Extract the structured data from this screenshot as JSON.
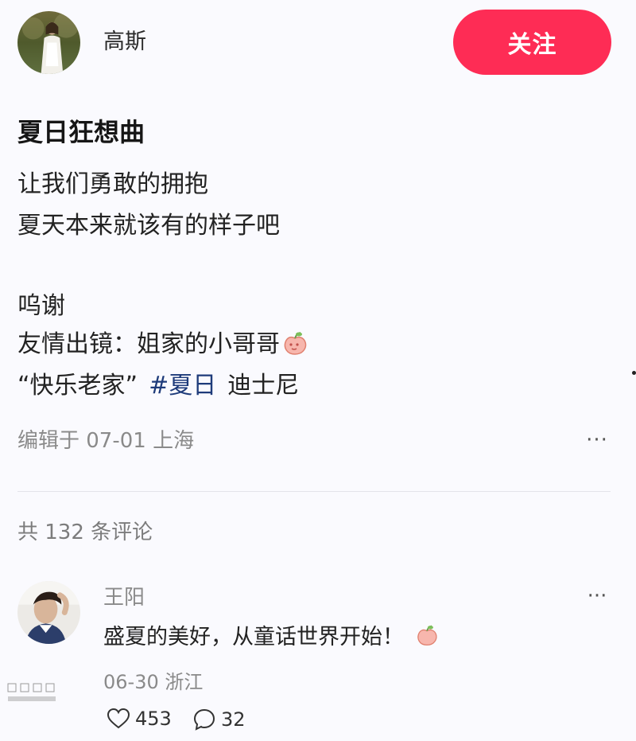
{
  "author": {
    "name": "高斯",
    "avatar_icon": "author-avatar-photo"
  },
  "follow_button": {
    "label": "关注",
    "color": "#fe2c55"
  },
  "post": {
    "title": "夏日狂想曲",
    "lines": [
      "让我们勇敢的拥抱",
      "夏天本来就该有的样子吧",
      "呜谢",
      "友情出镜：姐家的小哥哥"
    ],
    "tag_line": {
      "quote": "“快乐老家”",
      "hashtag": "#夏日",
      "place": "迪士尼"
    },
    "meta": "编辑于 07-01 上海",
    "more_label": "···",
    "hashtag_color": "#1e3b7a"
  },
  "comments": {
    "count_text": "共 132 条评论",
    "items": [
      {
        "author": "王阳",
        "text": "盛夏的美好，从童话世界开始！",
        "meta": "06-30 浙江",
        "likes": "453",
        "replies": "32",
        "more_label": "···"
      }
    ]
  }
}
